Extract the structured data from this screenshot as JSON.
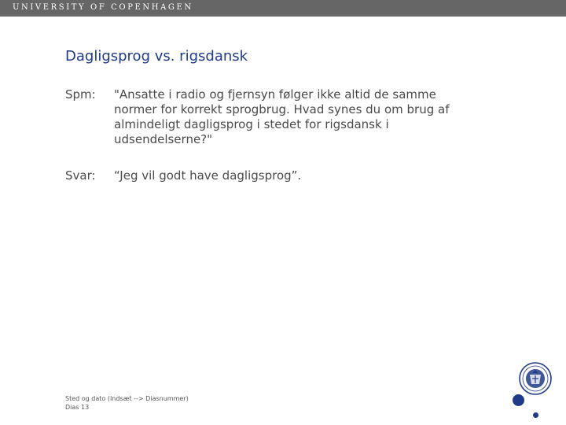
{
  "header": {
    "university": "UNIVERSITY OF COPENHAGEN"
  },
  "slide": {
    "title": "Dagligsprog vs. rigsdansk",
    "question_label": "Spm:",
    "question_text": "\"Ansatte i radio og fjernsyn følger ikke altid de samme normer for korrekt sprogbrug. Hvad synes du om brug af almindeligt dagligsprog i stedet for rigsdansk i udsendelserne?\"",
    "answer_label": "Svar:",
    "answer_text": "“Jeg vil godt have dagligsprog”."
  },
  "footer": {
    "line1": "Sted og dato (Indsæt --> Diasnummer)",
    "line2": "Dias 13"
  },
  "icons": {
    "logo": "university-seal-icon"
  },
  "colors": {
    "header_bar": "#666666",
    "title": "#1f3a86",
    "body_text": "#4a4a4a",
    "accent": "#1f3a86"
  }
}
